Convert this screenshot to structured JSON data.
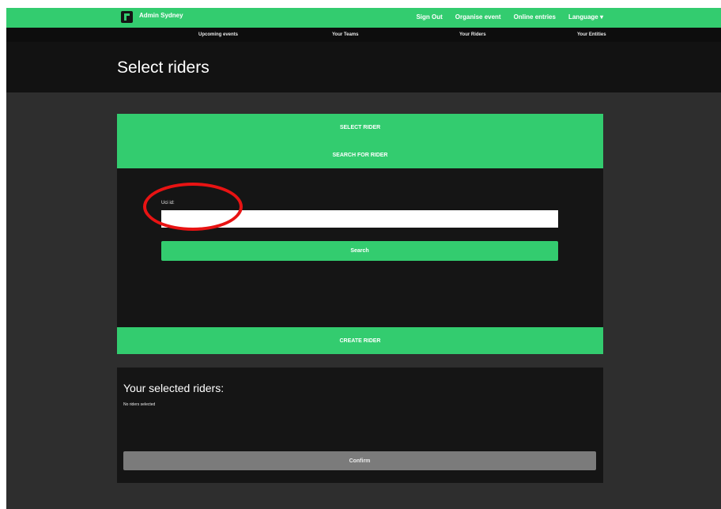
{
  "topbar": {
    "user_name": "Admin Sydney",
    "links": [
      "Sign Out",
      "Organise event",
      "Online entries",
      "Language ▾"
    ]
  },
  "subnav": {
    "items": [
      "Upcoming events",
      "Your Teams",
      "Your Riders",
      "Your Entities"
    ]
  },
  "page": {
    "title": "Select riders"
  },
  "search_panel": {
    "select_rider_label": "SELECT RIDER",
    "search_for_rider_label": "SEARCH FOR RIDER",
    "uci_label": "Uci id:",
    "uci_value": "",
    "search_button": "Search",
    "create_rider_label": "CREATE RIDER"
  },
  "selected_panel": {
    "title": "Your selected riders:",
    "empty_text": "No riders selected",
    "confirm_button": "Confirm"
  },
  "colors": {
    "accent": "#33cc6f",
    "highlight": "#e81313",
    "background": "#2e2e2e"
  }
}
